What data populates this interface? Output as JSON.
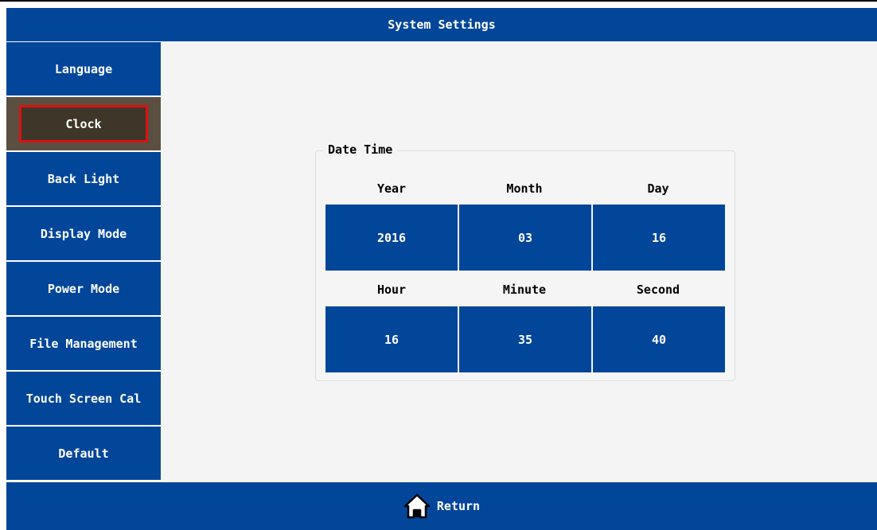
{
  "header": {
    "title": "System Settings"
  },
  "sidebar": {
    "items": [
      {
        "label": "Language"
      },
      {
        "label": "Clock"
      },
      {
        "label": "Back Light"
      },
      {
        "label": "Display Mode"
      },
      {
        "label": "Power Mode"
      },
      {
        "label": "File Management"
      },
      {
        "label": "Touch Screen Cal"
      },
      {
        "label": "Default"
      }
    ],
    "active": "Clock"
  },
  "datetime": {
    "title": "Date Time",
    "labels": {
      "year": "Year",
      "month": "Month",
      "day": "Day",
      "hour": "Hour",
      "minute": "Minute",
      "second": "Second"
    },
    "values": {
      "year": "2016",
      "month": "03",
      "day": "16",
      "hour": "16",
      "minute": "35",
      "second": "40"
    }
  },
  "footer": {
    "return_label": "Return",
    "icon": "home-icon"
  },
  "colors": {
    "primary": "#02469a",
    "active_bg": "#5a4f40",
    "highlight_border": "#e01010",
    "content_bg": "#f4f4f4"
  }
}
